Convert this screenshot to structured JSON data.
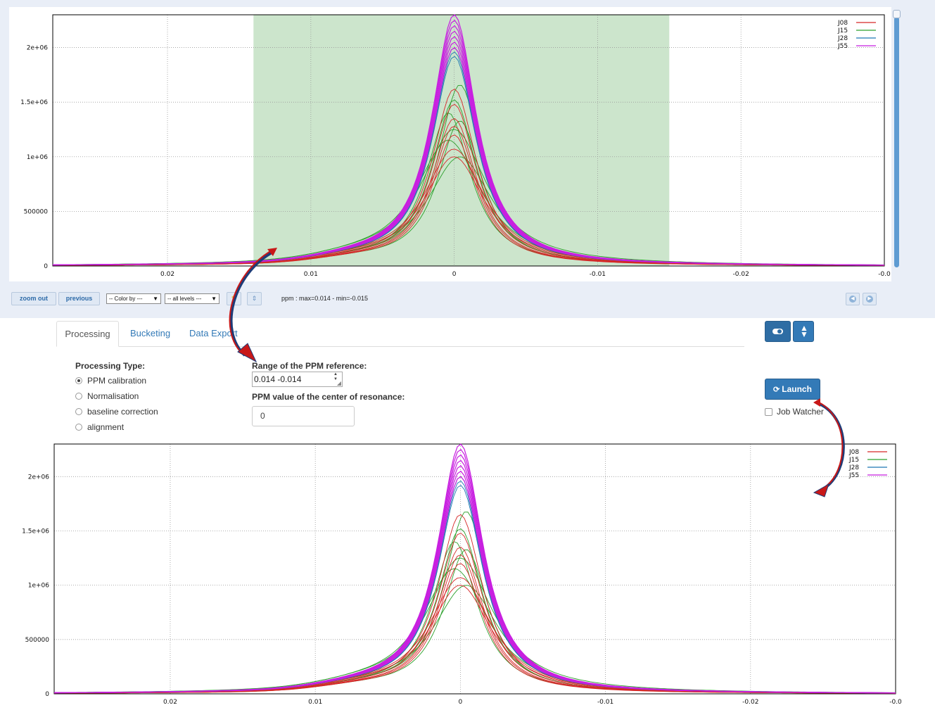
{
  "top_chart": {
    "chart_data": {
      "type": "line",
      "x_axis": {
        "ticks": [
          "0.02",
          "0.01",
          "0",
          "-0.01",
          "-0.02",
          "-0.0"
        ],
        "reversed": true,
        "xlim": [
          0.028,
          -0.03
        ]
      },
      "y_axis": {
        "ticks": [
          "0",
          "500000",
          "1e+06",
          "1.5e+06",
          "2e+06"
        ],
        "ylim": [
          0,
          2300000
        ]
      },
      "grid": true,
      "legend_placement": "top-right",
      "highlight_range": [
        0.014,
        -0.015
      ],
      "series": [
        {
          "name": "J08",
          "color": "#d62728",
          "peaks": [
            1620000,
            1480000,
            1350000,
            1280000,
            1200000,
            1070000,
            1000000
          ]
        },
        {
          "name": "J15",
          "color": "#2ca02c",
          "peaks": [
            1660000,
            1520000,
            1400000,
            1330000,
            1250000,
            1150000,
            1000000
          ]
        },
        {
          "name": "J28",
          "color": "#1f77b4",
          "peaks": [
            2000000,
            1960000,
            1920000
          ]
        },
        {
          "name": "J55",
          "color": "#c81fe0",
          "peaks": [
            2300000,
            2250000,
            2200000,
            2150000,
            2100000,
            2050000,
            2000000
          ]
        }
      ]
    }
  },
  "toolbar": {
    "zoom_out": "zoom out",
    "previous": "previous",
    "color_by": "-- Color by ---",
    "levels": "-- all levels ---",
    "ppm_info": "ppm : max=0.014 - min=-0.015"
  },
  "tabs": [
    {
      "label": "Processing"
    },
    {
      "label": "Bucketing"
    },
    {
      "label": "Data Export"
    }
  ],
  "processing": {
    "type_label": "Processing Type:",
    "options": [
      "PPM calibration",
      "Normalisation",
      "baseline correction",
      "alignment"
    ],
    "selected": 0
  },
  "form": {
    "range_label": "Range of the PPM reference:",
    "range_value": "0.014 -0.014",
    "center_label": "PPM value of the center of resonance:",
    "center_value": "0"
  },
  "actions": {
    "launch": "Launch",
    "job_watcher": "Job Watcher"
  },
  "bottom_chart": {
    "chart_data": {
      "type": "line",
      "x_axis": {
        "ticks": [
          "0.02",
          "0.01",
          "0",
          "-0.01",
          "-0.02",
          "-0.0"
        ],
        "reversed": true,
        "xlim": [
          0.028,
          -0.03
        ]
      },
      "y_axis": {
        "ticks": [
          "0",
          "500000",
          "1e+06",
          "1.5e+06",
          "2e+06"
        ],
        "ylim": [
          0,
          2300000
        ]
      },
      "grid": true,
      "legend_placement": "top-right",
      "series": [
        {
          "name": "J08",
          "color": "#d62728",
          "peaks": [
            1650000,
            1480000,
            1350000,
            1280000,
            1200000,
            1070000,
            1000000
          ]
        },
        {
          "name": "J15",
          "color": "#2ca02c",
          "peaks": [
            1680000,
            1520000,
            1400000,
            1330000,
            1250000,
            1150000,
            1000000
          ]
        },
        {
          "name": "J28",
          "color": "#1f77b4",
          "peaks": [
            2000000,
            1960000,
            1920000
          ]
        },
        {
          "name": "J55",
          "color": "#c81fe0",
          "peaks": [
            2300000,
            2250000,
            2200000,
            2150000,
            2100000,
            2050000,
            2000000
          ]
        }
      ]
    }
  }
}
